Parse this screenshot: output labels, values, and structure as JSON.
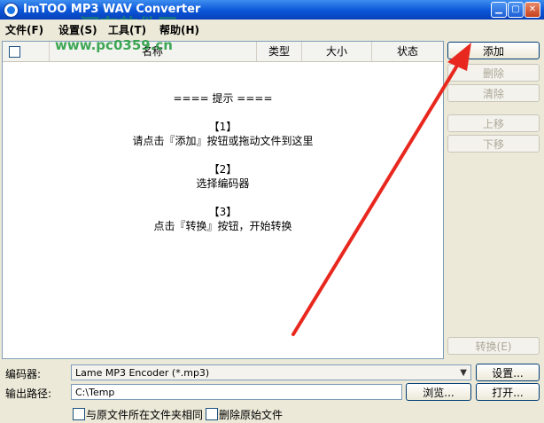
{
  "window": {
    "title": "ImTOO MP3 WAV Converter",
    "minimize": "▁",
    "maximize": "▢",
    "close": "✕"
  },
  "watermark": {
    "top_text": "河东软件网",
    "url": "www.pc0359.cn"
  },
  "menu": [
    {
      "label": "文件(F)"
    },
    {
      "label": "设置(S)"
    },
    {
      "label": "工具(T)"
    },
    {
      "label": "帮助(H)"
    }
  ],
  "list": {
    "columns": [
      "名称",
      "类型",
      "大小",
      "状态"
    ],
    "hints": [
      "==== 提示 ====",
      "",
      "【1】",
      "请点击『添加』按钮或拖动文件到这里",
      "",
      "【2】",
      "选择编码器",
      "",
      "【3】",
      "点击『转换』按钮，开始转换"
    ]
  },
  "buttons": {
    "add": "添加",
    "delete": "删除",
    "clear": "清除",
    "move_up": "上移",
    "move_down": "下移",
    "convert": "转换(E)",
    "settings": "设置...",
    "browse": "浏览...",
    "open": "打开..."
  },
  "encoder": {
    "label": "编码器:",
    "value": "Lame MP3 Encoder     (*.mp3)"
  },
  "output": {
    "label": "输出路径:",
    "value": "C:\\Temp"
  },
  "options": {
    "same_folder": "与原文件所在文件夹相同",
    "delete_original": "删除原始文件"
  },
  "colors": {
    "title_bar": "#0a55d8",
    "annotation_arrow": "#e8281e",
    "watermark": "#1f9a3c"
  }
}
